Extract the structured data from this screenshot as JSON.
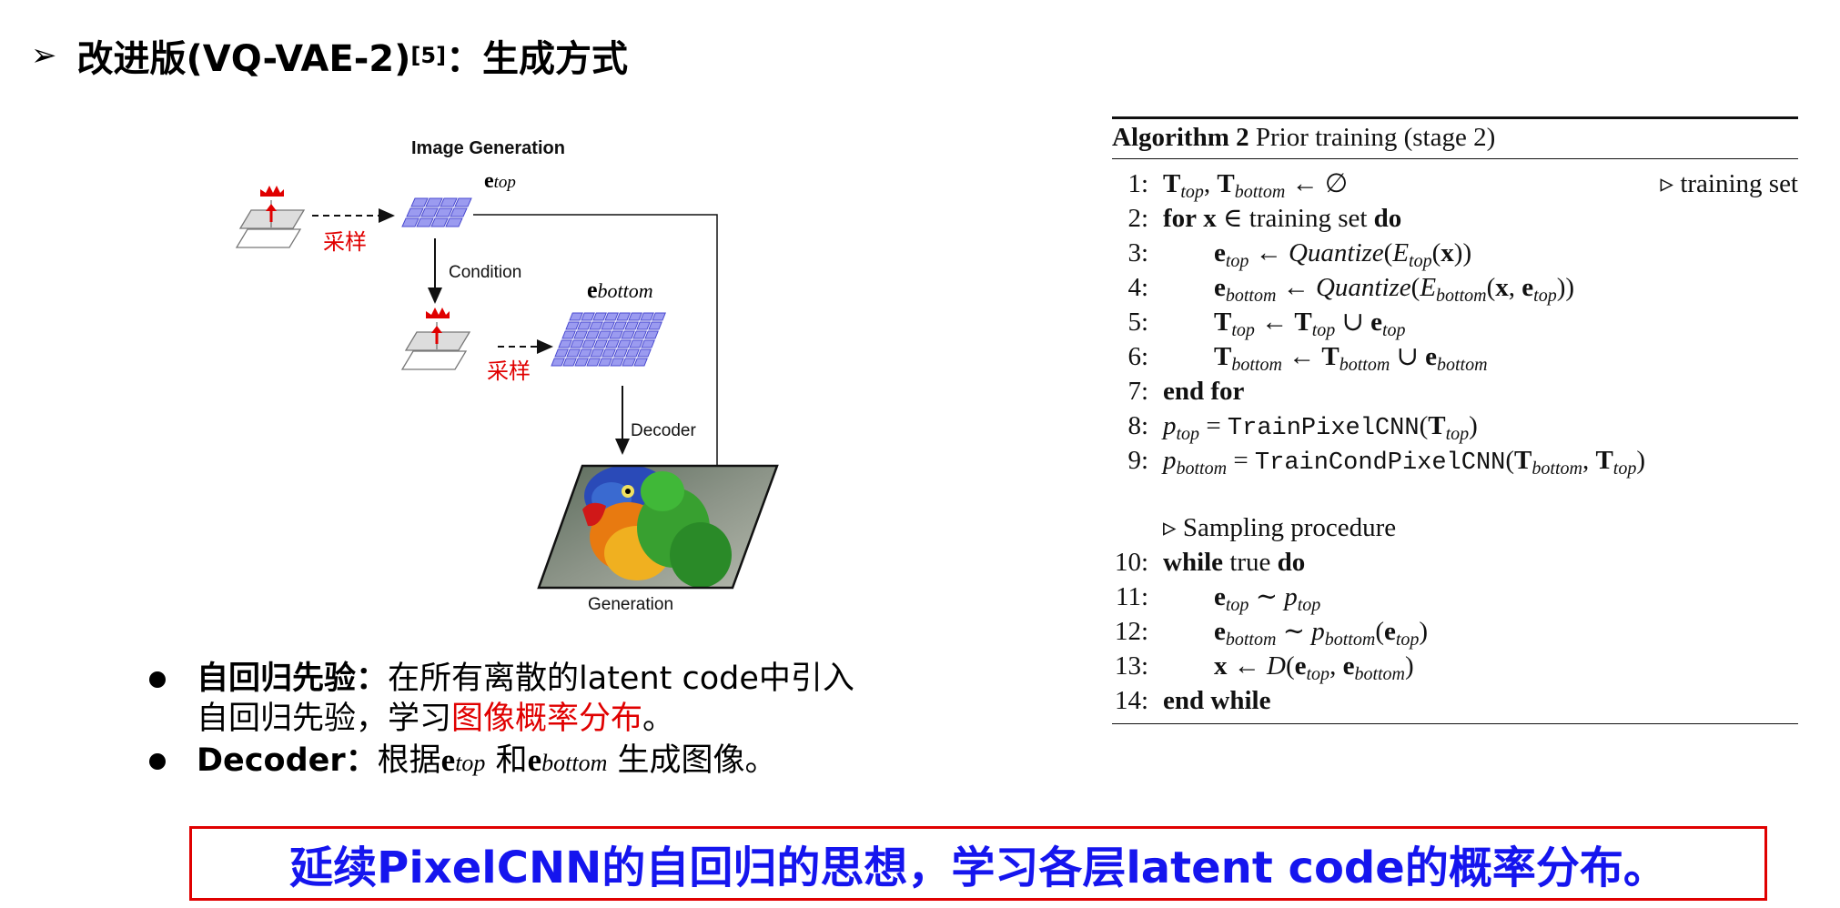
{
  "slide": {
    "title_prefix": "改进版(VQ-VAE-2)",
    "title_cite": "[5]",
    "title_suffix": "：生成方式"
  },
  "figure": {
    "heading": "Image Generation",
    "e_top": "top",
    "e_bottom": "bottom",
    "sample_label_1": "采样",
    "sample_label_2": "采样",
    "condition_label": "Condition",
    "decoder_label": "Decoder",
    "generation_label": "Generation"
  },
  "bullets": [
    {
      "term": "自回归先验：",
      "text_a": "在所有离散的latent code中引入",
      "text_b": "自回归先验，学习",
      "highlight": "图像概率分布",
      "text_c": "。"
    },
    {
      "term": "Decoder：",
      "text_a": "根据",
      "e_top_sub": "top",
      "and": "和",
      "e_bottom_sub": "bottom",
      "text_c": "生成图像。"
    }
  ],
  "algorithm": {
    "label": "Algorithm 2",
    "title": "Prior training (stage 2)",
    "comment_training_set": "training set",
    "sampling_comment": "Sampling procedure",
    "kw_for": "for",
    "kw_do": "do",
    "kw_end_for": "end for",
    "kw_while": "while",
    "kw_end_while": "end while",
    "training_set": "training set",
    "true": "true",
    "quantize": "Quantize",
    "fn_train": "TrainPixelCNN",
    "fn_train_cond": "TrainCondPixelCNN",
    "line_numbers": [
      "1:",
      "2:",
      "3:",
      "4:",
      "5:",
      "6:",
      "7:",
      "8:",
      "9:",
      "10:",
      "11:",
      "12:",
      "13:",
      "14:"
    ]
  },
  "conclusion": "延续PixelCNN的自回归的思想，学习各层latent code的概率分布。",
  "colors": {
    "accent_red": "#e00000",
    "conclusion_blue": "#1515ee",
    "grid_fill": "#9b9bf0",
    "grid_stroke": "#4a4ad0"
  }
}
